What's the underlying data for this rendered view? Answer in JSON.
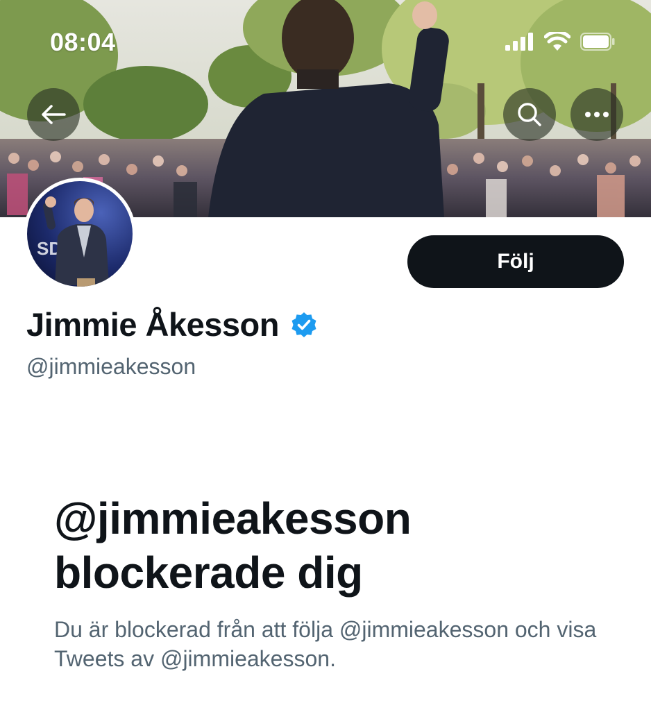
{
  "status_bar": {
    "time": "08:04",
    "icons": [
      "cellular-signal-icon",
      "wifi-icon",
      "battery-icon"
    ]
  },
  "banner": {
    "buttons": [
      "back-arrow-icon",
      "search-icon",
      "more-icon"
    ]
  },
  "profile": {
    "display_name": "Jimmie Åkesson",
    "verified": true,
    "handle": "@jimmieakesson",
    "follow_label": "Följ",
    "avatar_sign_text": "SD"
  },
  "blocked": {
    "title": "@jimmieakesson blockerade dig",
    "body": "Du är blockerad från att följa @jimmieakesson och visa Tweets av @jimmieakesson."
  },
  "colors": {
    "verified_badge": "#1d9bf0",
    "text_primary": "#0f1419",
    "text_secondary": "#536471",
    "follow_button_bg": "#0f1419"
  }
}
